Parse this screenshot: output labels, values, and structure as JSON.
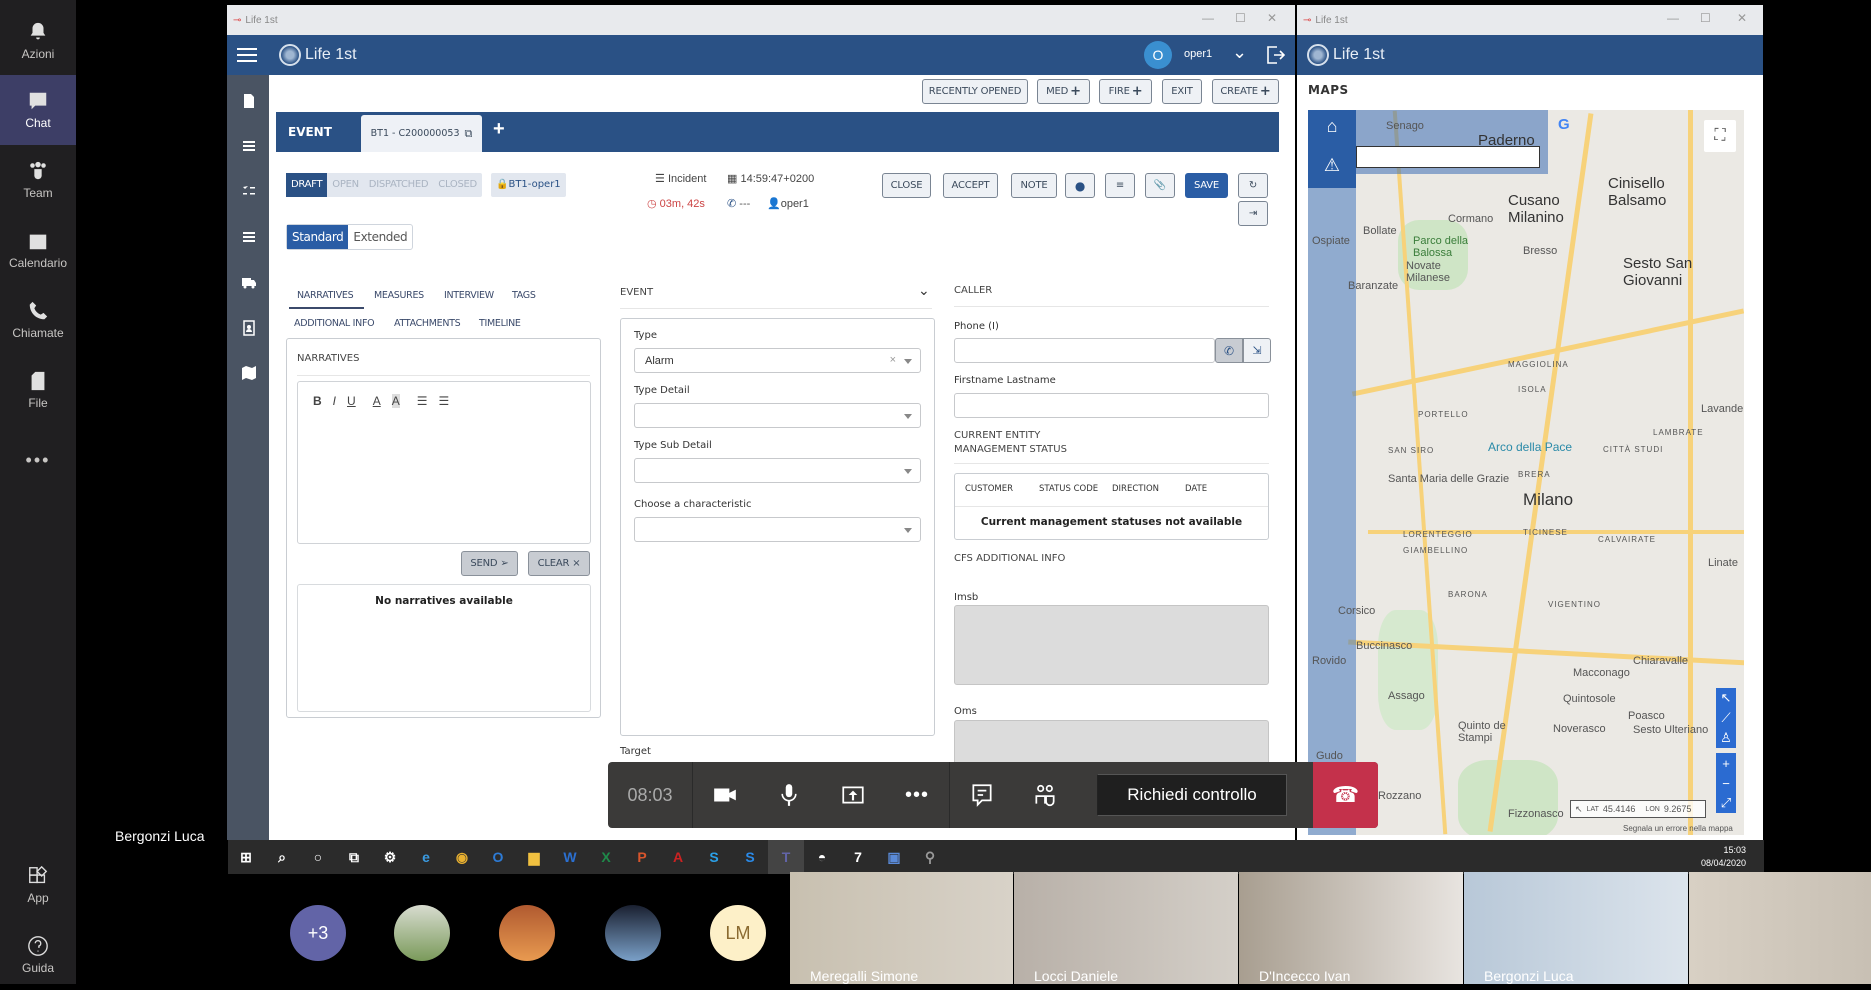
{
  "teams_rail": {
    "items": [
      {
        "label": "Azioni",
        "icon": "bell-icon"
      },
      {
        "label": "Chat",
        "icon": "chat-icon",
        "active": true
      },
      {
        "label": "Team",
        "icon": "team-icon"
      },
      {
        "label": "Calendario",
        "icon": "calendar-icon"
      },
      {
        "label": "Chiamate",
        "icon": "phone-icon"
      },
      {
        "label": "File",
        "icon": "file-icon"
      },
      {
        "label": "...",
        "icon": "more-icon"
      }
    ],
    "bottom": [
      {
        "label": "App",
        "icon": "apps-icon"
      },
      {
        "label": "Guida",
        "icon": "help-icon"
      }
    ]
  },
  "presenter_name": "Bergonzi Luca",
  "main_window": {
    "title": "Life 1st",
    "app_name": "Life 1st",
    "user": {
      "initial": "O",
      "name": "oper1"
    },
    "top_buttons": [
      "RECENTLY OPENED",
      "MED",
      "FIRE",
      "EXIT",
      "CREATE"
    ],
    "event_header": "EVENT",
    "event_tab": "BT1 - C200000053",
    "status_steps": [
      "DRAFT",
      "OPEN",
      "DISPATCHED",
      "CLOSED"
    ],
    "active_status": "DRAFT",
    "lock_label": "BT1-oper1",
    "event_kind": "Incident",
    "event_time": "14:59:47+0200",
    "elapsed": "03m, 42s",
    "phone_value": "---",
    "operator": "oper1",
    "action_buttons": [
      "CLOSE",
      "ACCEPT",
      "NOTE",
      "SAVE"
    ],
    "view_modes": [
      "Standard",
      "Extended"
    ],
    "active_view": "Standard",
    "tabs_row1": [
      "NARRATIVES",
      "MEASURES",
      "INTERVIEW",
      "TAGS"
    ],
    "tabs_row2": [
      "ADDITIONAL INFO",
      "ATTACHMENTS",
      "TIMELINE"
    ],
    "active_tab": "NARRATIVES",
    "narratives": {
      "title": "NARRATIVES",
      "toolbar": [
        "B",
        "I",
        "U",
        "A",
        "A"
      ],
      "send_label": "SEND ➢",
      "clear_label": "CLEAR ×",
      "empty_text": "No narratives available"
    },
    "event_section": {
      "title": "EVENT",
      "type_label": "Type",
      "type_value": "Alarm",
      "type_detail_label": "Type Detail",
      "type_sub_detail_label": "Type Sub Detail",
      "characteristic_label": "Choose a characteristic",
      "target_label": "Target"
    },
    "caller": {
      "title": "CALLER",
      "phone_label": "Phone (I)",
      "name_label": "Firstname Lastname",
      "status_title": "CURRENT ENTITY MANAGEMENT STATUS",
      "columns": [
        "CUSTOMER",
        "STATUS CODE",
        "DIRECTION",
        "DATE"
      ],
      "empty_text": "Current management statuses not available",
      "cfs_title": "CFS ADDITIONAL INFO",
      "imsb_label": "Imsb",
      "oms_label": "Oms"
    }
  },
  "map_window": {
    "title": "Life 1st",
    "app_name": "Life 1st",
    "section_title": "MAPS",
    "labels": [
      "Senago",
      "Paderno",
      "Cinisello Balsamo",
      "Cusano Milanino",
      "Bollate",
      "Cormano",
      "Parco della Balossa",
      "Bresso",
      "Sesto San Giovanni",
      "Novate Milanese",
      "Baranzate",
      "Ospiate",
      "Milano",
      "Arco della Pace",
      "Santa Maria delle Grazie",
      "PORTELLO",
      "ISOLA",
      "SAN SIRO",
      "BRERA",
      "CITTÀ STUDI",
      "LAMBRATE",
      "TICINESE",
      "LORENTEGGIO",
      "GIAMBELLINO",
      "CALVAIRATE",
      "BARONA",
      "VIGENTINO",
      "Corsico",
      "Buccinasco",
      "Rovido",
      "Assago",
      "Chiaravalle",
      "Macconago",
      "Quintosole",
      "Poasco",
      "Noverasco",
      "Sesto Ulteriano",
      "Rozzano",
      "Fizzonasco",
      "Gudo Gambaredo",
      "Quinto de Stampi",
      "Linate",
      "Lavanderie",
      "MAGGIOLINA"
    ],
    "lat_label": "LAT",
    "lat": "45.4146",
    "lon_label": "LON",
    "lon": "9.2675",
    "report_link": "Segnala un errore nella mappa"
  },
  "taskbar": {
    "time": "15:03",
    "date": "08/04/2020"
  },
  "call_bar": {
    "timer": "08:03",
    "request_control": "Richiedi controllo"
  },
  "participants": {
    "overflow": "+3",
    "initials": "LM",
    "videos": [
      "Meregalli Simone",
      "Locci Daniele",
      "D'Incecco Ivan",
      "Bergonzi Luca",
      ""
    ]
  }
}
